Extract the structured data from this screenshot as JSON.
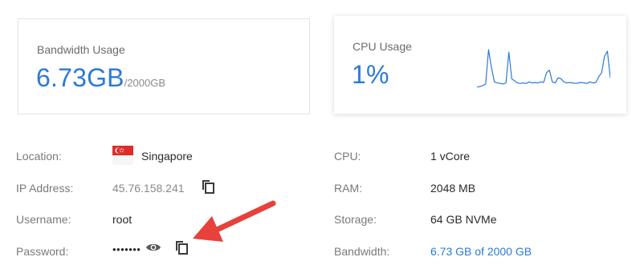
{
  "bandwidth": {
    "title": "Bandwidth Usage",
    "value": "6.73GB",
    "limit": "/2000GB"
  },
  "cpu_card": {
    "title": "CPU Usage",
    "value": "1%",
    "chart_data": {
      "type": "line",
      "series": [
        {
          "values": [
            2,
            3,
            5,
            8,
            75,
            40,
            12,
            10,
            9,
            8,
            10,
            70,
            18,
            14,
            10,
            9,
            10,
            9,
            12,
            10,
            11,
            10,
            12,
            11,
            30,
            35,
            12,
            10,
            20,
            18,
            12,
            10,
            11,
            10,
            9,
            10,
            11,
            10,
            9,
            12,
            10,
            11,
            22,
            30,
            62,
            72,
            20
          ]
        }
      ],
      "ylim": [
        0,
        100
      ],
      "color": "#2b7ad6"
    }
  },
  "details_left": [
    {
      "label": "Location:",
      "value": "Singapore",
      "icon": "singapore-flag-icon"
    },
    {
      "label": "IP Address:",
      "value": "45.76.158.241",
      "icon": "copy-icon"
    },
    {
      "label": "Username:",
      "value": "root"
    },
    {
      "label": "Password:",
      "value": "•••••••",
      "icons": [
        "eye-icon",
        "copy-icon"
      ]
    }
  ],
  "details_right": [
    {
      "label": "CPU:",
      "value": "1 vCore"
    },
    {
      "label": "RAM:",
      "value": "2048 MB"
    },
    {
      "label": "Storage:",
      "value": "64 GB NVMe"
    },
    {
      "label": "Bandwidth:",
      "value": "6.73 GB of 2000 GB"
    }
  ],
  "colors": {
    "accent": "#2b7ad6",
    "annotation_arrow": "#e8403a",
    "flag_red": "#e02b2b"
  }
}
